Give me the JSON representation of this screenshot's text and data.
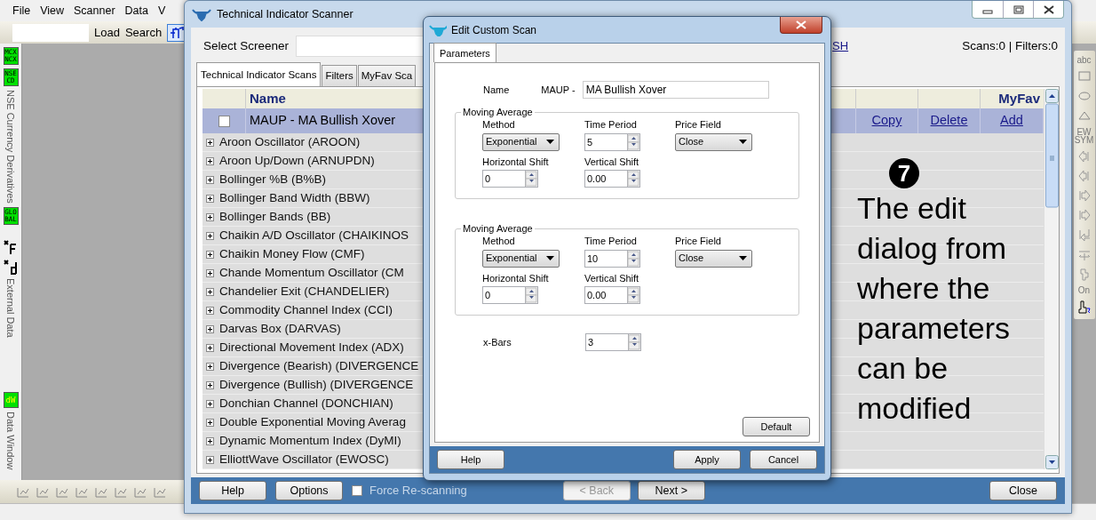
{
  "app": {
    "menu": [
      "File",
      "View",
      "Scanner",
      "Data",
      "V"
    ],
    "toolbar": {
      "buttons": [
        "Load",
        "Search"
      ]
    },
    "side_panel": [
      {
        "kind": "badge",
        "lines": [
          "MCX",
          "NCX"
        ]
      },
      {
        "kind": "badge",
        "lines": [
          "NSE",
          "CD"
        ]
      },
      {
        "kind": "vertical",
        "label": "NSE Currency Derivatives"
      },
      {
        "kind": "badge",
        "lines": [
          "GLO",
          "BAL"
        ]
      },
      {
        "kind": "function"
      },
      {
        "kind": "data"
      },
      {
        "kind": "vertical",
        "label": "External Data"
      },
      {
        "kind": "window",
        "label": "dW"
      },
      {
        "kind": "vertical",
        "label": "Data Window"
      }
    ],
    "drawing_toolbar": [
      {
        "kind": "text",
        "label": "abc"
      },
      {
        "kind": "rectangle"
      },
      {
        "kind": "ellipse"
      },
      {
        "kind": "triangle"
      },
      {
        "kind": "text",
        "label": "EW SYM"
      },
      {
        "kind": "first"
      },
      {
        "kind": "previous"
      },
      {
        "kind": "next"
      },
      {
        "kind": "last"
      },
      {
        "kind": "return"
      },
      {
        "kind": "offset"
      },
      {
        "kind": "edit"
      },
      {
        "kind": "text",
        "label": "On"
      },
      {
        "kind": "cursor"
      }
    ]
  },
  "scanner": {
    "title": "Technical Indicator Scanner",
    "screener_label": "Select Screener",
    "refresh_link": "SH",
    "counts": "Scans:0 | Filters:0",
    "tabs": [
      {
        "label": "Technical Indicator Scans",
        "selected": true
      },
      {
        "label": "Filters",
        "selected": false
      },
      {
        "label": "MyFav Sca",
        "selected": false
      }
    ],
    "columns": [
      "Name",
      "MyFav"
    ],
    "scan_row": {
      "checked": false,
      "name": "MAUP - MA Bullish Xover",
      "actions": [
        "Copy",
        "Delete",
        "Add"
      ]
    },
    "indicators": [
      {
        "name": "Aroon Oscillator (AROON)",
        "expanded": false
      },
      {
        "name": "Aroon Up/Down (ARNUPDN)",
        "expanded": false
      },
      {
        "name": "Bollinger %B (B%B)",
        "expanded": false
      },
      {
        "name": "Bollinger Band Width (BBW)",
        "expanded": false
      },
      {
        "name": "Bollinger Bands (BB)",
        "expanded": false
      },
      {
        "name": "Chaikin A/D Oscillator (CHAIKINOS",
        "expanded": false
      },
      {
        "name": "Chaikin Money Flow (CMF)",
        "expanded": false
      },
      {
        "name": "Chande Momentum Oscillator (CM",
        "expanded": false
      },
      {
        "name": "Chandelier Exit (CHANDELIER)",
        "expanded": false
      },
      {
        "name": "Commodity Channel Index (CCI)",
        "expanded": false
      },
      {
        "name": "Darvas Box (DARVAS)",
        "expanded": false
      },
      {
        "name": "Directional Movement Index (ADX)",
        "expanded": false
      },
      {
        "name": "Divergence (Bearish) (DIVERGENCE",
        "expanded": false
      },
      {
        "name": "Divergence (Bullish) (DIVERGENCE",
        "expanded": false
      },
      {
        "name": "Donchian Channel (DONCHIAN)",
        "expanded": false
      },
      {
        "name": "Double Exponential Moving Averag",
        "expanded": false
      },
      {
        "name": "Dynamic Momentum Index (DyMI)",
        "expanded": false
      },
      {
        "name": "ElliottWave Oscillator (EWOSC)",
        "expanded": false
      }
    ],
    "footer": {
      "left": [
        {
          "label": "Help",
          "disabled": false
        },
        {
          "label": "Options",
          "disabled": false
        }
      ],
      "force_rescan": {
        "label": "Force Re-scanning",
        "checked": false
      },
      "nav": [
        {
          "label": "< Back",
          "disabled": true
        },
        {
          "label": "Next >",
          "disabled": false
        }
      ],
      "close": "Close"
    }
  },
  "dialog": {
    "title": "Edit Custom Scan",
    "tabs": [
      {
        "label": "Parameters",
        "selected": true
      }
    ],
    "name": {
      "label": "Name",
      "prefix": "MAUP -",
      "value": "MA Bullish Xover"
    },
    "groups": [
      {
        "title": "Moving Average",
        "fields": [
          {
            "kind": "select",
            "label": "Method",
            "value": "Exponential"
          },
          {
            "kind": "spin",
            "label": "Time Period",
            "value": "5"
          },
          {
            "kind": "select",
            "label": "Price Field",
            "value": "Close"
          },
          {
            "kind": "spin",
            "label": "Horizontal Shift",
            "value": "0"
          },
          {
            "kind": "spin",
            "label": "Vertical Shift",
            "value": "0.00"
          }
        ]
      },
      {
        "title": "Moving Average",
        "fields": [
          {
            "kind": "select",
            "label": "Method",
            "value": "Exponential"
          },
          {
            "kind": "spin",
            "label": "Time Period",
            "value": "10"
          },
          {
            "kind": "select",
            "label": "Price Field",
            "value": "Close"
          },
          {
            "kind": "spin",
            "label": "Horizontal Shift",
            "value": "0"
          },
          {
            "kind": "spin",
            "label": "Vertical Shift",
            "value": "0.00"
          }
        ]
      }
    ],
    "x_bars": {
      "label": "x-Bars",
      "value": "3"
    },
    "default_button": "Default",
    "footer": [
      "Help",
      "Apply",
      "Cancel"
    ]
  },
  "annotation": {
    "number": "7",
    "text": "The edit dialog from where the parameters can be modified"
  }
}
